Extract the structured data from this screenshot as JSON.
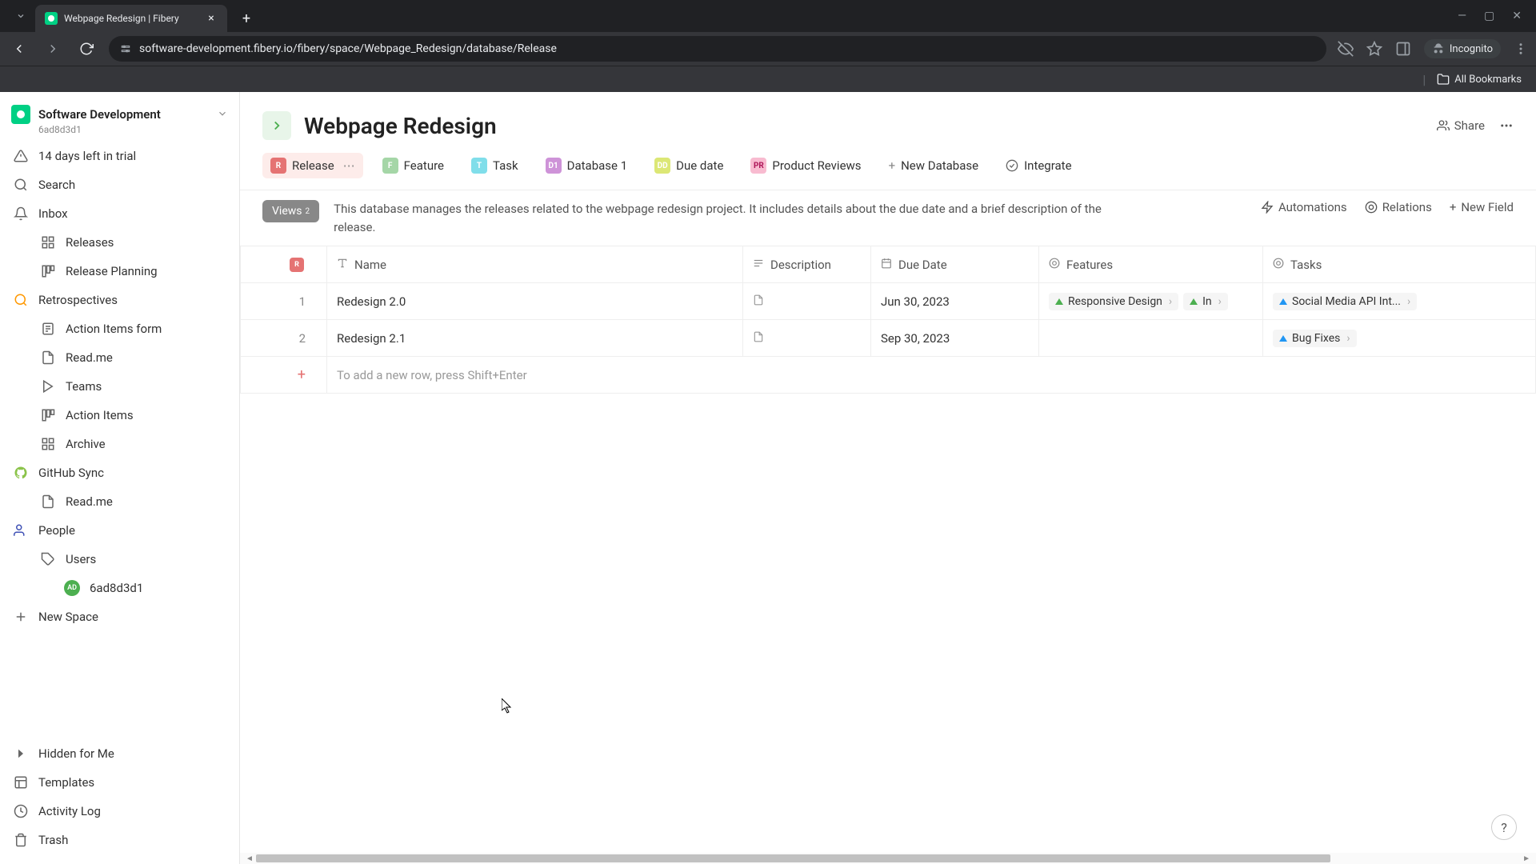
{
  "browser": {
    "tab_title": "Webpage Redesign | Fibery",
    "url": "software-development.fibery.io/fibery/space/Webpage_Redesign/database/Release",
    "incognito_label": "Incognito",
    "all_bookmarks": "All Bookmarks"
  },
  "workspace": {
    "name": "Software Development",
    "id": "6ad8d3d1"
  },
  "sidebar": {
    "trial": "14 days left in trial",
    "search": "Search",
    "inbox": "Inbox",
    "items": {
      "releases": "Releases",
      "release_planning": "Release Planning",
      "retrospectives": "Retrospectives",
      "action_items_form": "Action Items form",
      "readme1": "Read.me",
      "teams": "Teams",
      "action_items": "Action Items",
      "archive": "Archive",
      "github_sync": "GitHub Sync",
      "readme2": "Read.me",
      "people": "People",
      "users": "Users",
      "user_id": "6ad8d3d1",
      "new_space": "New Space"
    },
    "bottom": {
      "hidden": "Hidden for Me",
      "templates": "Templates",
      "activity_log": "Activity Log",
      "trash": "Trash"
    }
  },
  "page": {
    "title": "Webpage Redesign",
    "share": "Share"
  },
  "db_tabs": {
    "release": "Release",
    "feature": "Feature",
    "task": "Task",
    "database1": "Database 1",
    "due_date": "Due date",
    "product_reviews": "Product Reviews",
    "new_database": "New Database",
    "integrate": "Integrate"
  },
  "toolbar": {
    "views": "Views",
    "views_count": "2",
    "description": "This database manages the releases related to the webpage redesign project. It includes details about the due date and a brief description of the release.",
    "automations": "Automations",
    "relations": "Relations",
    "new_field": "New Field"
  },
  "columns": {
    "idx_badge": "R",
    "name": "Name",
    "description": "Description",
    "due_date": "Due Date",
    "features": "Features",
    "tasks": "Tasks"
  },
  "rows": [
    {
      "idx": "1",
      "name": "Redesign 2.0",
      "due_date": "Jun 30, 2023",
      "features": [
        "Responsive Design",
        "In"
      ],
      "tasks": [
        "Social Media API Int..."
      ]
    },
    {
      "idx": "2",
      "name": "Redesign 2.1",
      "due_date": "Sep 30, 2023",
      "features": [],
      "tasks": [
        "Bug Fixes"
      ]
    }
  ],
  "add_row": "To add a new row, press Shift+Enter",
  "user_avatar_initials": "AD"
}
